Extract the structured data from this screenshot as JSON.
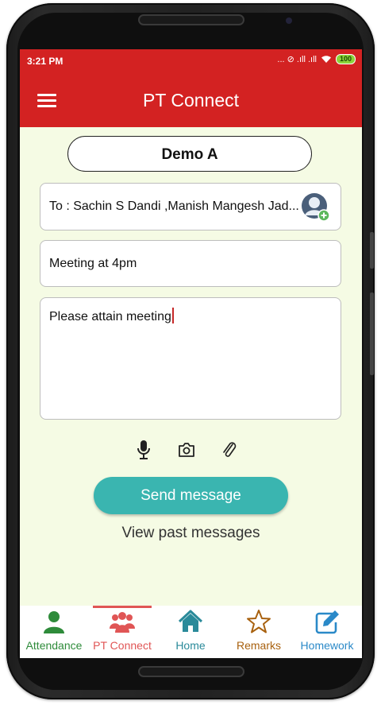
{
  "status_bar": {
    "time": "3:21 PM",
    "signal_text": "... ⊘ .ıll .ıll",
    "battery": "100"
  },
  "app_bar": {
    "title": "PT Connect"
  },
  "class_name": "Demo A",
  "compose": {
    "to_value": "To : Sachin S Dandi ,Manish Mangesh Jad...",
    "subject_value": "Meeting at 4pm",
    "body_value": "Please attain meeting"
  },
  "tools": [
    "microphone-icon",
    "camera-icon",
    "paperclip-icon"
  ],
  "send_label": "Send message",
  "past_label": "View past messages",
  "nav": {
    "items": [
      {
        "label": "Attendance",
        "icon": "person-icon",
        "color": "#2e8b3a"
      },
      {
        "label": "PT Connect",
        "icon": "group-icon",
        "color": "#e05555",
        "active": true
      },
      {
        "label": "Home",
        "icon": "home-icon",
        "color": "#2a8a9a"
      },
      {
        "label": "Remarks",
        "icon": "star-icon",
        "color": "#a8610f"
      },
      {
        "label": "Homework",
        "icon": "edit-icon",
        "color": "#2a89c8"
      }
    ]
  },
  "colors": {
    "accent": "#d32222",
    "send_button": "#3ab5b0",
    "background": "#f5fbe4"
  }
}
